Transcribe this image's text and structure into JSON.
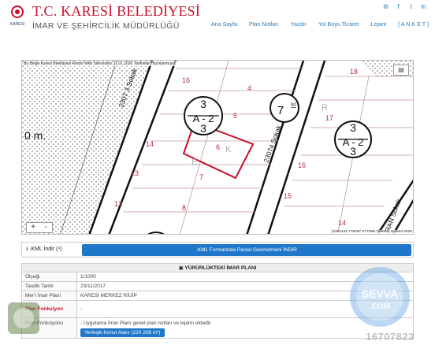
{
  "header": {
    "logo_text": "KARESİ",
    "brand_title": "T.C. KARESİ BELEDİYESİ",
    "brand_subtitle": "İMAR VE ŞEHİRCİLİK MÜDÜRLÜĞÜ",
    "social": [
      "⚙",
      "f",
      "t",
      "in"
    ],
    "nav": [
      "Ana Sayfa",
      "Plan Notları",
      "Yazdır",
      "Yol Boyu Ticaret",
      "Lejant",
      "[ A N K E T ]"
    ]
  },
  "map": {
    "note": "Bu Belge Karesi Belediyesi Resmi Web Sitesinden 31.01.2026 Tarihinde Hazırlanmıştır.",
    "zoom_in": "+",
    "zoom_out": "-",
    "layers_icon": "layers-icon",
    "coordinates": "[4393132.779287-577066.769806] Nested 2026",
    "labels": {
      "street1": "2307 3 Sokak",
      "street2": "23074 Sokak",
      "street3": "RAN Sokak",
      "distance": "0 m.",
      "p16": "16",
      "p4": "4",
      "p18": "18",
      "p15": "15",
      "p5": "5",
      "p17": "17",
      "p14": "14",
      "p6": "6",
      "p16b": "16",
      "p13": "13",
      "p7": "7",
      "p12": "12",
      "p8": "8",
      "p15b": "15",
      "p14b": "14",
      "sym1_top": "3",
      "sym1_mid": "A - 2",
      "sym1_bot": "3",
      "sym2_top": "7",
      "sym2_bot": "00",
      "sym3_top": "3",
      "sym3_mid": "A - 2",
      "sym3_bot": "3",
      "street_letters_k": "K",
      "street_letters_e": "E",
      "street_letters_r": "R"
    }
  },
  "kml": {
    "label": ".KML İndir (⁴)",
    "button": ".KML Formatında Parsel Geometrisini İNDİR"
  },
  "plan": {
    "title": "YÜRÜRLÜKTEKİ İMAR PLANI",
    "rows": [
      {
        "k": "Ölçeği",
        "v": "1/1000"
      },
      {
        "k": "Tasdik Tarihi",
        "v": "23/11/2017"
      },
      {
        "k": "Mer'i İmar Planı",
        "v": "KARESİ MERKEZ RİUİP"
      }
    ],
    "function_key": "Plan Fonksiyon",
    "function_value": "-",
    "notes_key": "Plan Fonksiyonu",
    "notes_value": "- Uygulama İmar Planı genel plan notları ve lejantı ektedir.",
    "zone_button": "Yerleşik Konut Alanı (220.208 m²)"
  },
  "watermark": {
    "brand": "SEVVA",
    "domain": ".COM",
    "code": "16707823"
  },
  "colors": {
    "brand_red": "#c8102e",
    "link_blue": "#2a7db8",
    "button_blue": "#1f77c9",
    "parcel_red": "#c8102e"
  }
}
